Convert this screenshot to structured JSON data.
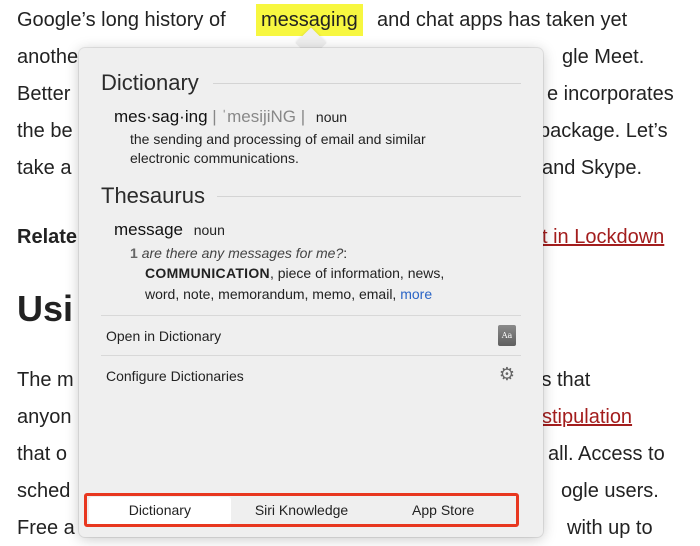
{
  "article": {
    "line1_a": "Google’s long history of",
    "line1_b": "and chat apps has taken yet",
    "line2_a": "anothe",
    "line2_b": "gle Meet.",
    "line3_a": "Better",
    "line3_b": "e incorporates",
    "line4_a": "the be",
    "line4_b": "package. Let’s",
    "line5_a": "take a",
    "line5_b": "and Skype.",
    "related_a": "Relate",
    "related_link": "t in Lockdown",
    "heading": "Usi",
    "p1_a": "The m",
    "p1_b": "is that",
    "p2_a": "anyon",
    "p2_link": "stipulation",
    "p3_a": "that o",
    "p3_b": "all. Access to",
    "p4_a": "sched",
    "p4_b": "ogle users.",
    "p5_a": "Free a",
    "p5_b": "with up to",
    "highlighted_word": "messaging"
  },
  "popover": {
    "dictionary_title": "Dictionary",
    "headword": "mes·sag·ing",
    "pronunciation": "| ˈmesijiNG |",
    "part_of_speech": "noun",
    "definition_line1": "the sending and processing of email and similar",
    "definition_line2": "electronic communications.",
    "thesaurus_title": "Thesaurus",
    "th_headword": "message",
    "th_part_of_speech": "noun",
    "sense_number": "1",
    "example": "are there any messages for me?",
    "example_suffix": ":",
    "synonym_main": "COMMUNICATION",
    "synonyms_line1_rest": ", piece of information, news,",
    "synonyms_line2": "word, note, memorandum, memo, email,",
    "more_link": "more",
    "open_in_dictionary": "Open in Dictionary",
    "configure_dictionaries": "Configure Dictionaries",
    "dict_icon_text": "Aa"
  },
  "tabs": [
    {
      "label": "Dictionary",
      "active": true
    },
    {
      "label": "Siri Knowledge",
      "active": false
    },
    {
      "label": "App Store",
      "active": false
    }
  ],
  "colors": {
    "highlight": "#f7f740",
    "link": "#a31d1d",
    "more_link": "#2a64c6",
    "annotation_box": "#e8371f"
  },
  "icons": {
    "dictionary_app": "dictionary-book-icon",
    "configure": "gear-icon"
  }
}
